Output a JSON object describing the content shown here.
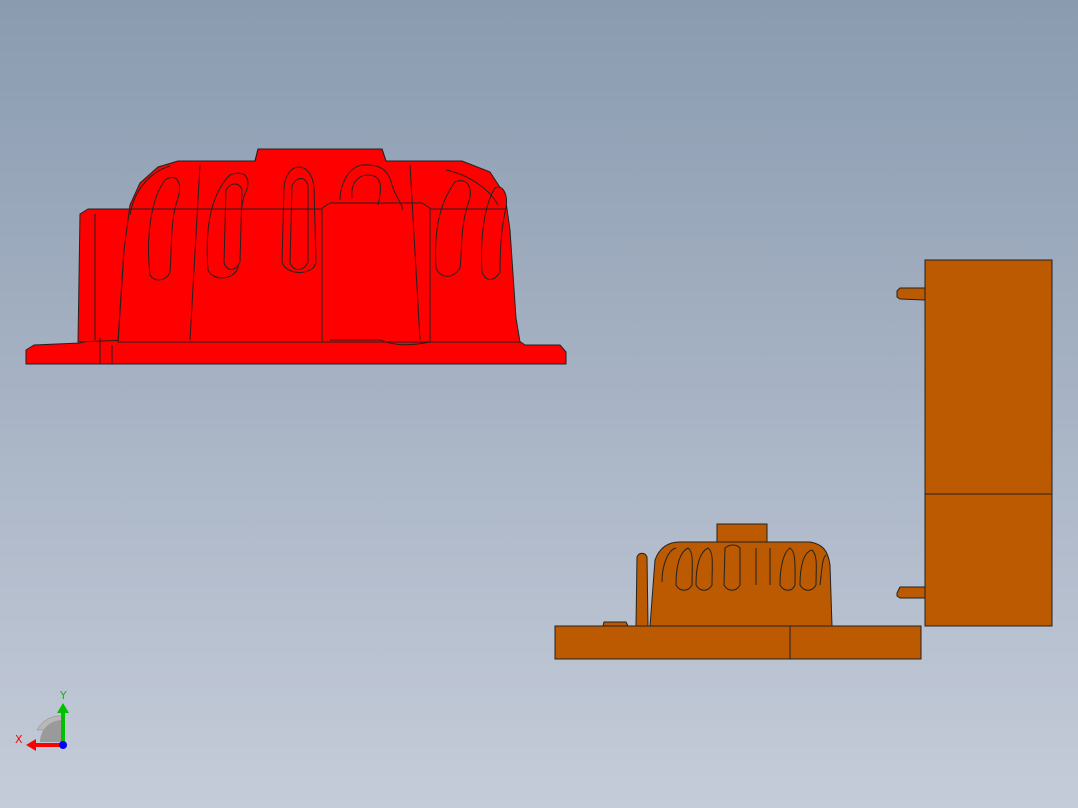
{
  "viewport": {
    "background_top": "#8a9bb0",
    "background_bottom": "#c5ccd9"
  },
  "models": {
    "cover_part_color": "#ff0000",
    "mold_assembly_color": "#bb5a00",
    "edge_color": "#222222"
  },
  "triad": {
    "x_label": "X",
    "y_label": "Y",
    "x_color": "#ff0000",
    "y_color": "#00c000",
    "z_color": "#0000ff"
  }
}
